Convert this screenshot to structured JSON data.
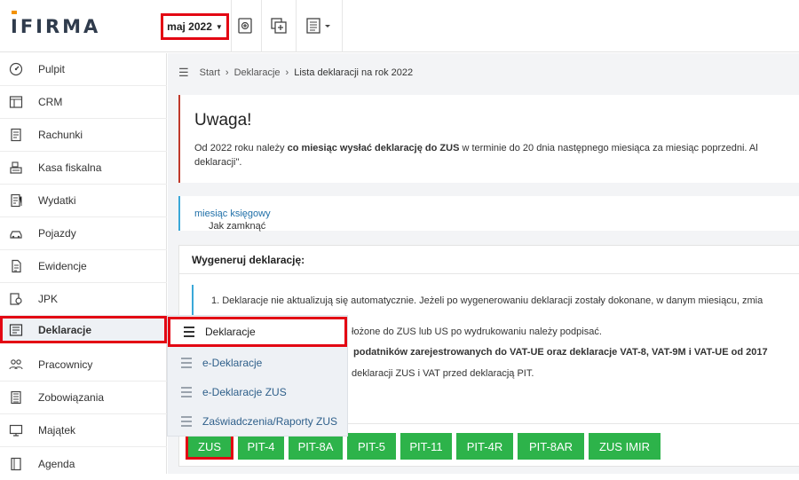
{
  "header": {
    "logo": "IFIRMA",
    "month_selector": "maj 2022"
  },
  "sidebar": {
    "items": [
      {
        "label": "Pulpit",
        "icon": "dashboard-icon"
      },
      {
        "label": "CRM",
        "icon": "crm-icon"
      },
      {
        "label": "Rachunki",
        "icon": "invoice-icon"
      },
      {
        "label": "Kasa fiskalna",
        "icon": "cash-register-icon"
      },
      {
        "label": "Wydatki",
        "icon": "expenses-icon"
      },
      {
        "label": "Pojazdy",
        "icon": "car-icon"
      },
      {
        "label": "Ewidencje",
        "icon": "records-icon"
      },
      {
        "label": "JPK",
        "icon": "jpk-icon"
      },
      {
        "label": "Deklaracje",
        "icon": "declarations-icon"
      },
      {
        "label": "Pracownicy",
        "icon": "employees-icon"
      },
      {
        "label": "Zobowiązania",
        "icon": "liabilities-icon"
      },
      {
        "label": "Majątek",
        "icon": "assets-icon"
      },
      {
        "label": "Agenda",
        "icon": "agenda-icon"
      }
    ],
    "active": "Deklaracje"
  },
  "breadcrumb": {
    "items": [
      "Start",
      "Deklaracje"
    ],
    "current": "Lista deklaracji na rok 2022"
  },
  "alert": {
    "title": "Uwaga!",
    "text_before": "Od 2022 roku należy ",
    "text_bold": "co miesiąc wysłać deklarację do ZUS",
    "text_after": " w terminie do 20 dnia następnego miesiąca za miesiąc poprzedni. Al",
    "text_line2": "deklaracji\"."
  },
  "info": {
    "text": "Jak zamknąć ",
    "link": "miesiąc księgowy"
  },
  "generate": {
    "title": "Wygeneruj deklarację:",
    "notes": [
      "1. Deklaracje nie aktualizują się automatycznie. Jeżeli po wygenerowaniu deklaracji zostały dokonane, w danym miesiącu, zmia",
      "łożone do ZUS lub US po wydrukowaniu należy podpisać.",
      "podatników zarejestrowanych do VAT-UE oraz deklaracje VAT-8, VAT-9M i VAT-UE od 2017",
      "deklaracji ZUS i VAT przed deklaracją PIT."
    ],
    "buttons": [
      "ZUS",
      "PIT-4",
      "PIT-8A",
      "PIT-5",
      "PIT-11",
      "PIT-4R",
      "PIT-8AR",
      "ZUS IMIR"
    ]
  },
  "dropdown": {
    "items": [
      "Deklaracje",
      "e-Deklaracje",
      "e-Deklaracje ZUS",
      "Zaświadczenia/Raporty ZUS"
    ],
    "active": "Deklaracje"
  },
  "colors": {
    "accent_red": "#e30613",
    "button_green": "#2db34a",
    "link_blue": "#1f6fa8"
  }
}
